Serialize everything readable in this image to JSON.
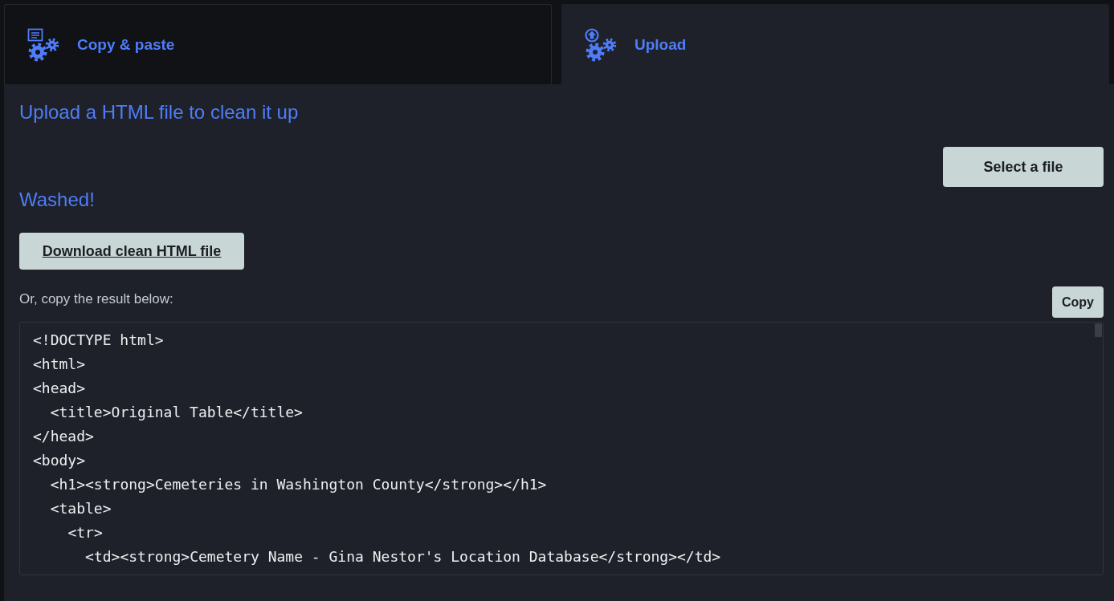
{
  "tabs": [
    {
      "label": "Copy & paste",
      "kind": "paste",
      "selected": false
    },
    {
      "label": "Upload",
      "kind": "upload",
      "selected": true
    }
  ],
  "upload": {
    "heading": "Upload a HTML file to clean it up",
    "select_button": "Select a file",
    "status": "Washed!",
    "download_button": "Download clean HTML file",
    "copy_prompt": "Or, copy the result below:",
    "copy_button": "Copy",
    "code": [
      {
        "text": "<!DOCTYPE html>"
      },
      {
        "text": "<html>"
      },
      {
        "text": "<head>",
        "children": [
          {
            "text": "<title>Original Table</title>"
          }
        ]
      },
      {
        "text": "</head>"
      },
      {
        "text": "<body>",
        "children": [
          {
            "text": "<h1><strong>Cemeteries in Washington County</strong></h1>"
          },
          {
            "text": "<table>",
            "children": [
              {
                "text": "<tr>",
                "children": [
                  {
                    "text": "<td><strong>Cemetery Name - Gina Nestor's Location Database</strong></td>"
                  }
                ]
              }
            ]
          }
        ]
      }
    ]
  }
}
